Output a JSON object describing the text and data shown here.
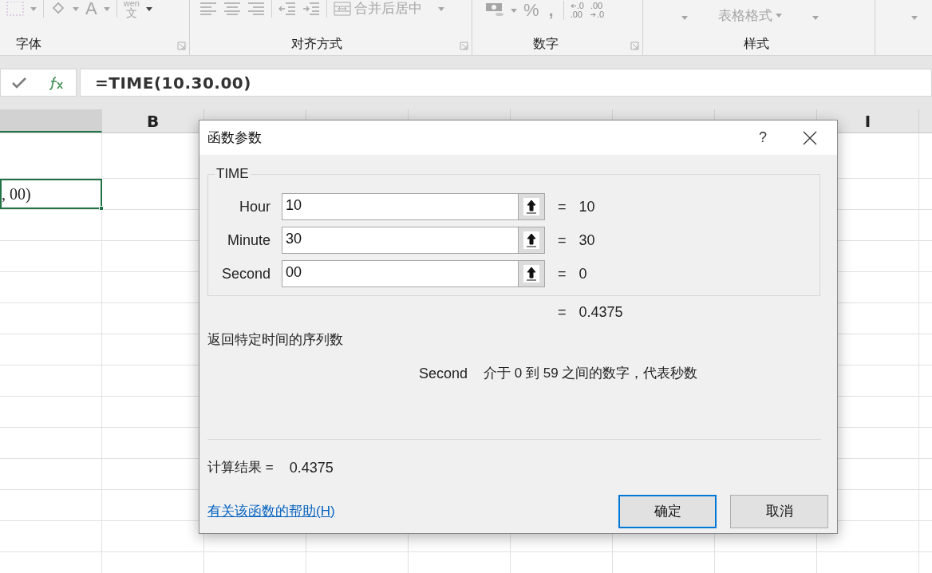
{
  "ribbon": {
    "font_tools": {
      "phonetic_top": "wen",
      "phonetic_bottom": "文",
      "font_color": "A"
    },
    "merge_button": "合并后居中",
    "number_tools": {
      "percent": "%",
      "comma": ","
    },
    "decimal_buttons": [
      {
        "top": ".0",
        "bottom": ".00"
      },
      {
        "top": ".00",
        "bottom": ".0"
      }
    ],
    "table_format": "表格格式",
    "groups": [
      {
        "label": "字体"
      },
      {
        "label": "对齐方式"
      },
      {
        "label": "数字"
      },
      {
        "label": "样式"
      }
    ]
  },
  "formula_bar": {
    "formula": "=TIME(10.30.00)"
  },
  "sheet": {
    "columns": [
      {
        "selected": true
      },
      {
        "label": "B",
        "selected": false
      },
      {
        "selected": false
      },
      {
        "selected": false
      },
      {
        "selected": false
      },
      {
        "selected": false
      },
      {
        "selected": false
      },
      {
        "selected": false
      },
      {
        "label": "I",
        "selected": false
      }
    ],
    "active_cell": {
      "text": ", 00)"
    }
  },
  "dialog": {
    "title": "函数参数",
    "help": "?",
    "function_name": "TIME",
    "args": [
      {
        "name": "Hour",
        "value": "10",
        "equals": "=",
        "result": "10"
      },
      {
        "name": "Minute",
        "value": "30",
        "equals": "=",
        "result": "30"
      },
      {
        "name": "Second",
        "value": "00",
        "equals": "=",
        "result": "0"
      }
    ],
    "total": {
      "equals": "=",
      "result": "0.4375"
    },
    "description": "返回特定时间的序列数",
    "arg_help": {
      "name": "Second",
      "text": "介于 0 到 59 之间的数字，代表秒数"
    },
    "formula_result_label": "计算结果 =",
    "formula_result": "0.4375",
    "help_link": "有关该函数的帮助(H)",
    "buttons": [
      {
        "label": "确定",
        "default": true
      },
      {
        "label": "取消",
        "default": false
      }
    ]
  }
}
